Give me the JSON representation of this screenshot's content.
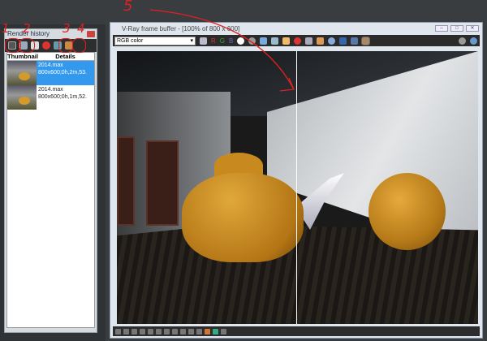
{
  "history": {
    "title": "Render history",
    "columns": [
      "Thumbnail",
      "Details"
    ],
    "rows": [
      {
        "name": "2014.max",
        "info": "800x600;0h,2m,53.",
        "selected": true
      },
      {
        "name": "2014.max",
        "info": "800x600;0h,1m,52."
      }
    ],
    "tools": [
      "power-icon",
      "save-icon",
      "load-icon",
      "record-icon",
      "compare-a-icon",
      "compare-b-icon"
    ]
  },
  "vfb": {
    "title": "V-Ray frame buffer - [100% of 800 x 600]",
    "channel": "RGB color",
    "window_buttons": [
      "–",
      "□",
      "✕"
    ],
    "tool_labels": {
      "r": "R",
      "g": "G",
      "b": "B"
    }
  },
  "annotations": [
    "1",
    "2",
    "3",
    "4",
    "5"
  ],
  "colors": {
    "accent": "#3399ee",
    "annotation": "#e02020"
  }
}
